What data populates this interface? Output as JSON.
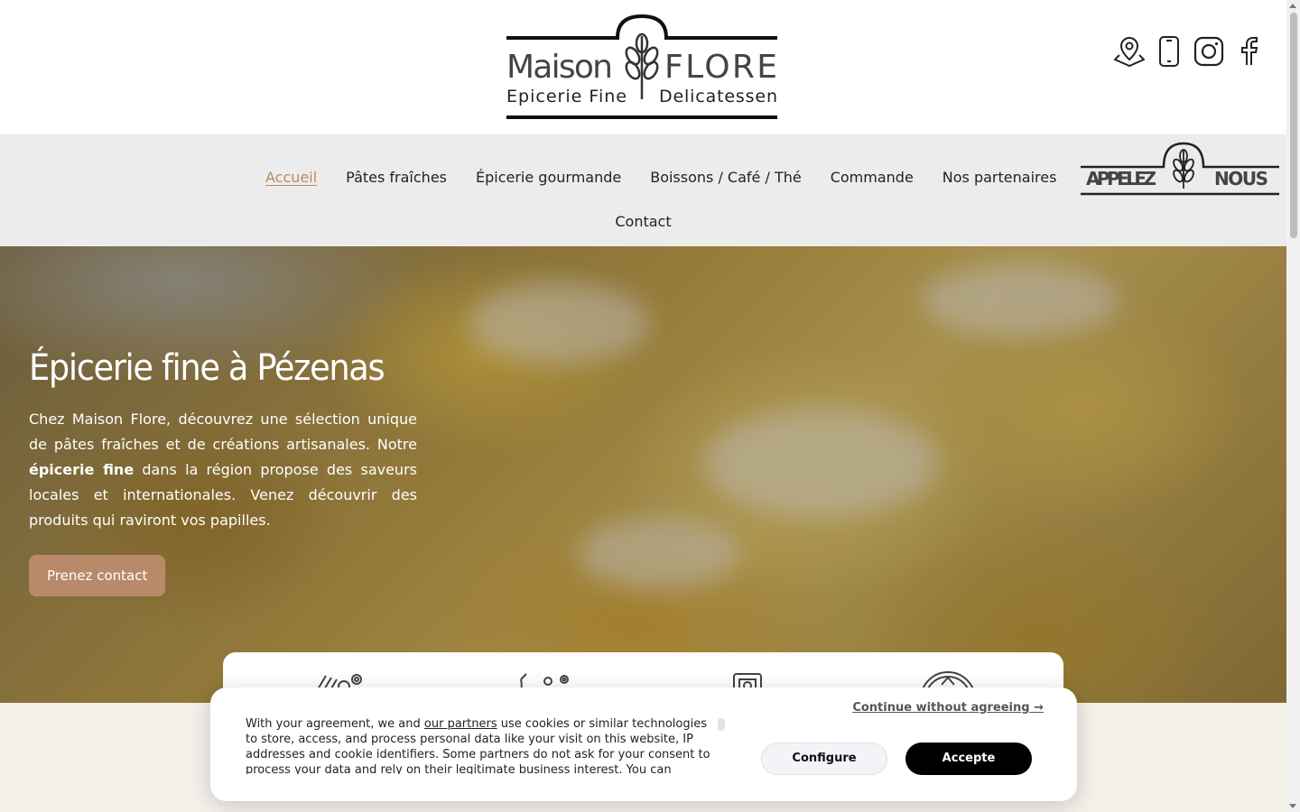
{
  "header": {
    "logo": {
      "brand_left": "Maison",
      "brand_right": "FLORE",
      "tagline_left": "Epicerie Fine",
      "tagline_right": "Delicatessen"
    },
    "social_icons": [
      "map-pin-icon",
      "phone-icon",
      "instagram-icon",
      "facebook-icon"
    ]
  },
  "nav": {
    "items": [
      {
        "label": "Accueil",
        "active": true
      },
      {
        "label": "Pâtes fraîches"
      },
      {
        "label": "Épicerie gourmande"
      },
      {
        "label": "Boissons / Café / Thé"
      },
      {
        "label": "Commande"
      },
      {
        "label": "Nos partenaires"
      },
      {
        "label": "Contact"
      }
    ],
    "call_button": {
      "left": "APPELEZ",
      "right": "NOUS"
    }
  },
  "hero": {
    "title": "Épicerie fine à Pézenas",
    "text_1": "Chez Maison Flore, découvrez une sélection unique de pâtes fraîches et de créations artisanales. Notre ",
    "text_bold": "épicerie fine",
    "text_2": " dans la région propose des saveurs locales et internationales. Venez découvrir des produits qui raviront vos papilles.",
    "button": "Prenez contact"
  },
  "features": {
    "icons": [
      "pasta-icon",
      "herbs-icon",
      "shop-icon",
      "badge-icon"
    ]
  },
  "cookie": {
    "continue": "Continue without agreeing →",
    "text_before": "With your agreement, we and ",
    "link": "our partners",
    "text_after": " use cookies or similar technologies to store, access, and process personal data like your visit on this website, IP addresses and cookie identifiers. Some partners do not ask for your consent to process your data and rely on their legitimate business interest. You can",
    "configure": "Configure",
    "accept": "Accepte"
  },
  "colors": {
    "accent": "#b98a63",
    "nav_bg": "#ececec",
    "hero_button": "#b98a6a"
  }
}
